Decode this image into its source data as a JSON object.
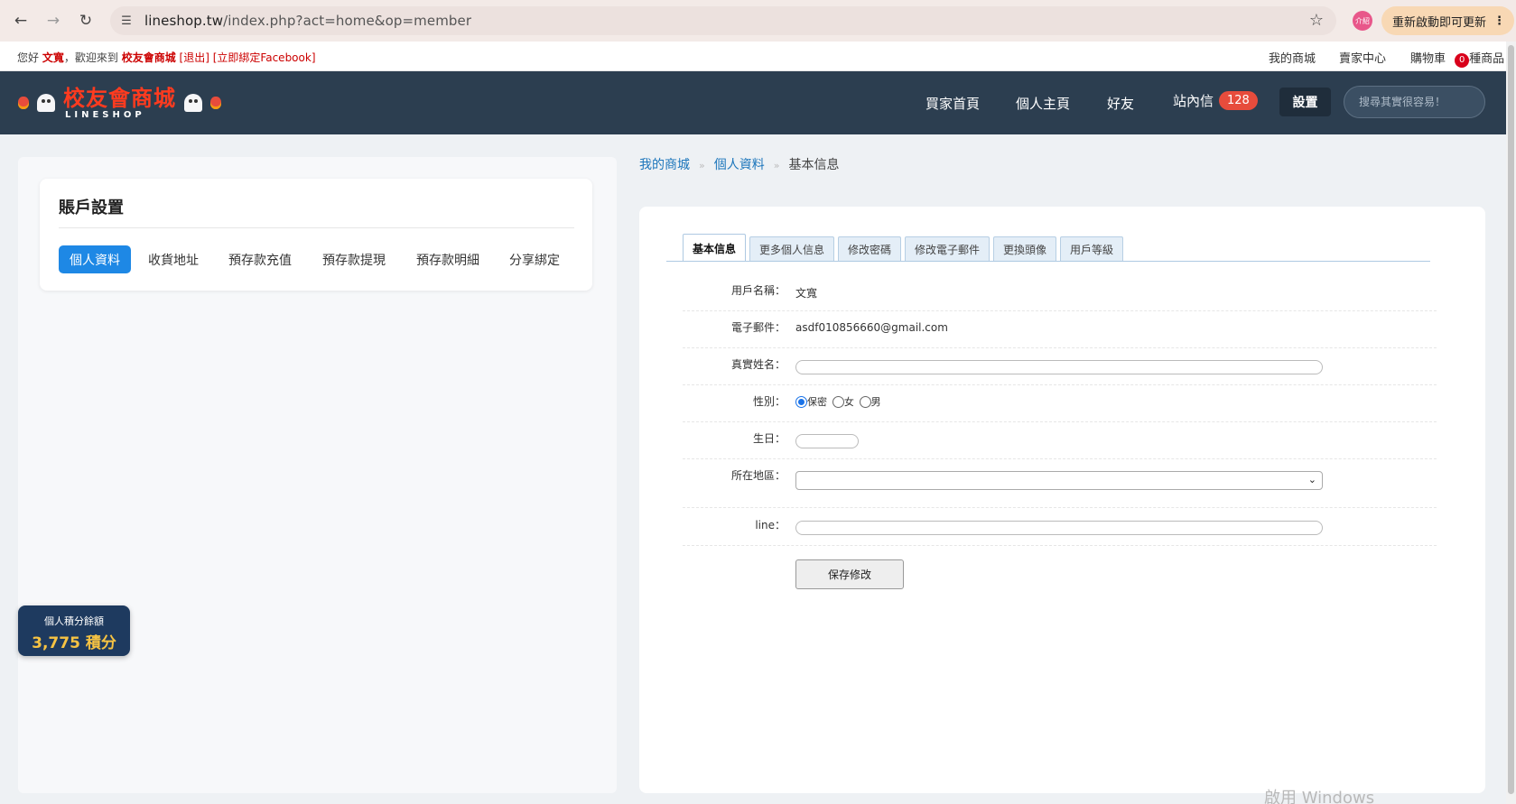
{
  "browser": {
    "url": "lineshop.tw",
    "url_path": "/index.php?act=home&op=member",
    "ext_avatar": "介紹",
    "update_label": "重新啟動即可更新",
    "icons": [
      "back-arrow-icon",
      "forward-arrow-icon",
      "reload-icon",
      "site-info-icon",
      "star-icon",
      "menu-dots-icon"
    ]
  },
  "topbar": {
    "greeting": "您好",
    "username": "文寬",
    "welcome": "，歡迎來到",
    "shop_name": "校友會商城",
    "logout": "[退出]",
    "bind_facebook": "[立即綁定Facebook]",
    "my_shop": "我的商城",
    "seller_center": "賣家中心",
    "cart": "購物車",
    "cart_count": "0",
    "cart_suffix": "種商品"
  },
  "header": {
    "logo_cn": "校友會商城",
    "logo_en": "LINESHOP",
    "nav": {
      "buyer_home": "買家首頁",
      "personal_home": "個人主頁",
      "friends": "好友",
      "messages": "站內信",
      "message_count": "128",
      "settings": "設置"
    },
    "search_placeholder": "搜尋其實很容易！"
  },
  "account": {
    "title": "賬戶設置",
    "tabs": [
      "個人資料",
      "收貨地址",
      "預存款充值",
      "預存款提現",
      "預存款明細",
      "分享綁定"
    ],
    "active_tab": "個人資料"
  },
  "points": {
    "label": "個人積分餘額",
    "value": "3,775 積分"
  },
  "breadcrumb": {
    "items": [
      "我的商城",
      "個人資料",
      "基本信息"
    ],
    "separator": "»"
  },
  "form": {
    "tabs": [
      "基本信息",
      "更多個人信息",
      "修改密碼",
      "修改電子郵件",
      "更換頭像",
      "用戶等級"
    ],
    "labels": {
      "username": "用戶名稱：",
      "email": "電子郵件：",
      "realname": "真實姓名：",
      "gender": "性別：",
      "birthday": "生日：",
      "region": "所在地區：",
      "line": "line："
    },
    "values": {
      "username": "文寬",
      "email": "asdf010856660@gmail.com",
      "realname": "",
      "birthday": "",
      "line": ""
    },
    "gender_options": [
      "保密",
      "女",
      "男"
    ],
    "gender_selected": "保密",
    "save_label": "保存修改"
  },
  "watermark": "啟用 Windows"
}
